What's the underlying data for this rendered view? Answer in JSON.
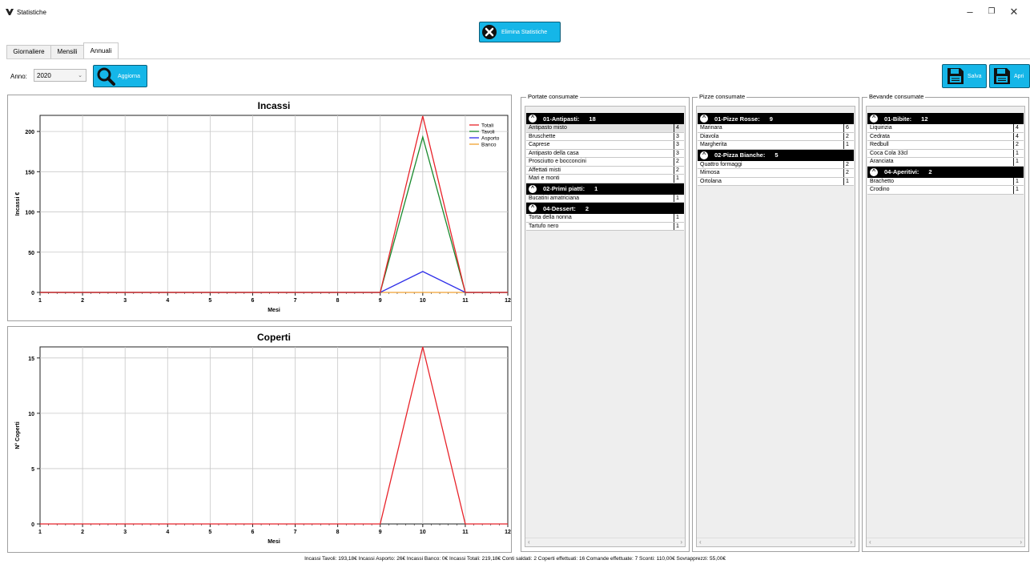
{
  "window": {
    "title": "Statistiche",
    "controls": {
      "minimize": "–",
      "maximize": "❐",
      "close": "✕"
    }
  },
  "toolbar": {
    "delete_stats": "Elimina Statistiche"
  },
  "tabs": [
    {
      "label": "Giornaliere"
    },
    {
      "label": "Mensili"
    },
    {
      "label": "Annuali"
    }
  ],
  "year_filter": {
    "label": "Anno:",
    "value": "2020",
    "refresh": "Aggiorna"
  },
  "file_actions": {
    "save": "Salva",
    "open": "Apri"
  },
  "colors": {
    "accent": "#15b6e8",
    "totali": "#e8232a",
    "tavoli": "#1a8a2e",
    "asporto": "#2e2ee8",
    "banco": "#f0a030"
  },
  "chart_data": [
    {
      "type": "line",
      "title": "Incassi",
      "xlabel": "Mesi",
      "ylabel": "Incassi €",
      "x": [
        1,
        2,
        3,
        4,
        5,
        6,
        7,
        8,
        9,
        10,
        11,
        12
      ],
      "xlim": [
        1,
        12
      ],
      "ylim": [
        0,
        220
      ],
      "yticks": [
        0,
        50,
        100,
        150,
        200
      ],
      "grid": true,
      "legend": "top-right",
      "series": [
        {
          "name": "Totali",
          "color": "#e8232a",
          "values": [
            0,
            0,
            0,
            0,
            0,
            0,
            0,
            0,
            0,
            219.18,
            0,
            0
          ]
        },
        {
          "name": "Tavoli",
          "color": "#1a8a2e",
          "values": [
            0,
            0,
            0,
            0,
            0,
            0,
            0,
            0,
            0,
            193.18,
            0,
            0
          ]
        },
        {
          "name": "Asporto",
          "color": "#2e2ee8",
          "values": [
            0,
            0,
            0,
            0,
            0,
            0,
            0,
            0,
            0,
            26,
            0,
            0
          ]
        },
        {
          "name": "Banco",
          "color": "#f0a030",
          "values": [
            0,
            0,
            0,
            0,
            0,
            0,
            0,
            0,
            0,
            0,
            0,
            0
          ]
        }
      ]
    },
    {
      "type": "line",
      "title": "Coperti",
      "xlabel": "Mesi",
      "ylabel": "N° Coperti",
      "x": [
        1,
        2,
        3,
        4,
        5,
        6,
        7,
        8,
        9,
        10,
        11,
        12
      ],
      "xlim": [
        1,
        12
      ],
      "ylim": [
        0,
        16
      ],
      "yticks": [
        0,
        5,
        10,
        15
      ],
      "grid": true,
      "series": [
        {
          "color": "#e8232a",
          "values": [
            0,
            0,
            0,
            0,
            0,
            0,
            0,
            0,
            0,
            16,
            0,
            0
          ]
        }
      ]
    }
  ],
  "portate": {
    "title": "Portate consumate",
    "categories": [
      {
        "name": "01-Antipasti:",
        "count": "18",
        "items": [
          {
            "name": "Antipasto misto",
            "qty": "4"
          },
          {
            "name": "Bruschette",
            "qty": "3"
          },
          {
            "name": "Caprese",
            "qty": "3"
          },
          {
            "name": "Antipasto della casa",
            "qty": "3"
          },
          {
            "name": "Prosciutto e bocconcini",
            "qty": "2"
          },
          {
            "name": "Affettati misti",
            "qty": "2"
          },
          {
            "name": "Mari e monti",
            "qty": "1"
          }
        ]
      },
      {
        "name": "02-Primi piatti:",
        "count": "1",
        "items": [
          {
            "name": "Bucatini amatriciana",
            "qty": "1"
          }
        ]
      },
      {
        "name": "04-Dessert:",
        "count": "2",
        "items": [
          {
            "name": "Torta della nonna",
            "qty": "1"
          },
          {
            "name": "Tartufo nero",
            "qty": "1"
          }
        ]
      }
    ]
  },
  "pizze": {
    "title": "Pizze consumate",
    "categories": [
      {
        "name": "01-Pizze Rosse:",
        "count": "9",
        "items": [
          {
            "name": "Marinara",
            "qty": "6"
          },
          {
            "name": "Diavola",
            "qty": "2"
          },
          {
            "name": "Margherita",
            "qty": "1"
          }
        ]
      },
      {
        "name": "02-Pizza Bianche:",
        "count": "5",
        "items": [
          {
            "name": "Quattro formaggi",
            "qty": "2"
          },
          {
            "name": "Mimosa",
            "qty": "2"
          },
          {
            "name": "Ortolana",
            "qty": "1"
          }
        ]
      }
    ]
  },
  "bevande": {
    "title": "Bevande consumate",
    "categories": [
      {
        "name": "01-Bibite:",
        "count": "12",
        "items": [
          {
            "name": "Liquirizia",
            "qty": "4"
          },
          {
            "name": "Cedrata",
            "qty": "4"
          },
          {
            "name": "Redbull",
            "qty": "2"
          },
          {
            "name": "Coca Cola 33cl",
            "qty": "1"
          },
          {
            "name": "Aranciata",
            "qty": "1"
          }
        ]
      },
      {
        "name": "04-Aperitivi:",
        "count": "2",
        "items": [
          {
            "name": "Brachetto",
            "qty": "1"
          },
          {
            "name": "Crodino",
            "qty": "1"
          }
        ]
      }
    ]
  },
  "status": "Incassi Tavoli: 193,18€  Incassi Asporto: 26€  Incassi Banco: 0€  Incassi Totali: 219,18€    Conti saldati: 2    Coperti effettuati: 16    Comande effettuate: 7    Sconti: 110,00€    Sovrapprezzi: 55,00€"
}
